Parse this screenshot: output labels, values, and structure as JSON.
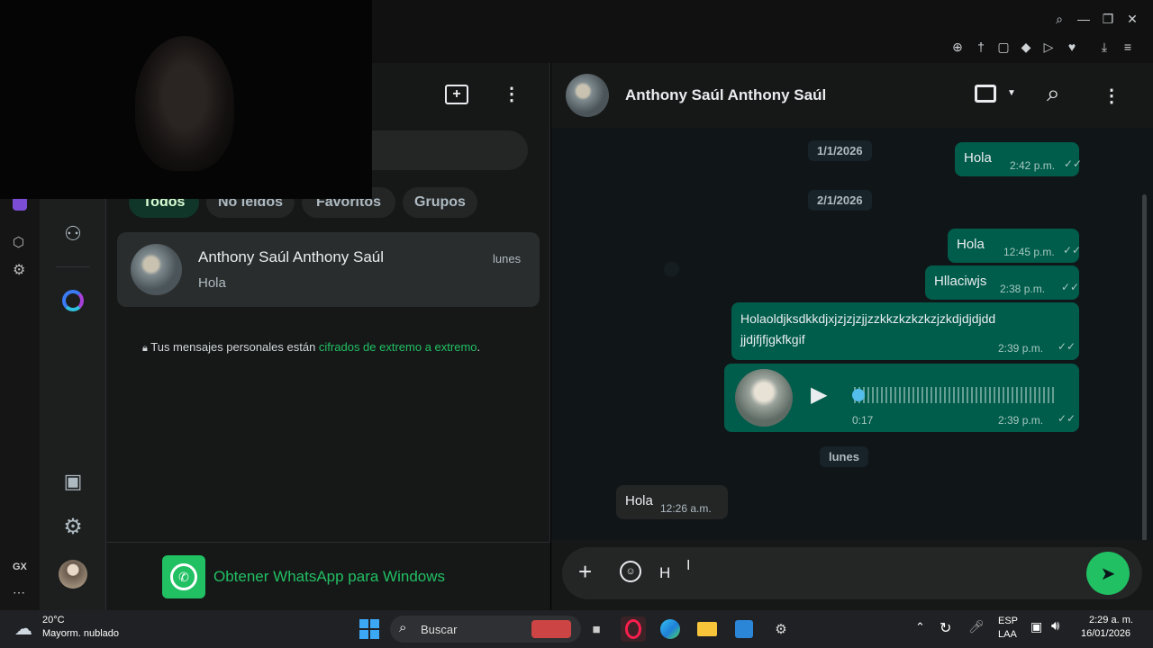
{
  "chat_list": {
    "filters": [
      "Todos",
      "No leídos",
      "Favoritos",
      "Grupos"
    ],
    "chat_item": {
      "name": "Anthony Saúl Anthony Saúl",
      "last_message": "Hola",
      "time": "lunes"
    },
    "encryption_prefix": "Tus mensajes personales están ",
    "encryption_link": "cifrados de extremo a extremo",
    "encryption_suffix": ".",
    "promo": "Obtener WhatsApp para Windows"
  },
  "chat": {
    "contact_name": "Anthony Saúl Anthony Saúl",
    "date_1": "1/1/2026",
    "date_2": "2/1/2026",
    "date_3": "lunes",
    "messages": [
      {
        "text": "Hola",
        "time": "2:42 p.m."
      },
      {
        "text": "Hola",
        "time": "12:45 p.m."
      },
      {
        "text": "Hllaciwjs",
        "time": "2:38 p.m."
      },
      {
        "text_line1": "Holaoldjksdkkdjxjzjzjzjjzzkkzkzkzkzjzkdjdjdjdd",
        "text_line2": "jjdjfjfjgkfkgif",
        "time": "2:39 p.m."
      },
      {
        "duration": "0:17",
        "time": "2:39 p.m."
      },
      {
        "text": "Hola",
        "time": "12:26 a.m."
      }
    ],
    "composer_value": "H"
  },
  "taskbar": {
    "weather_temp": "20°C",
    "weather_desc": "Mayorm. nublado",
    "search_label": "Buscar",
    "lang_line1": "ESP",
    "lang_line2": "LAA",
    "clock_time": "2:29 a. m.",
    "clock_date": "16/01/2026"
  },
  "colors": {
    "accent": "#21c063",
    "bubble_out": "#005c4b",
    "link_green": "#21c063"
  }
}
